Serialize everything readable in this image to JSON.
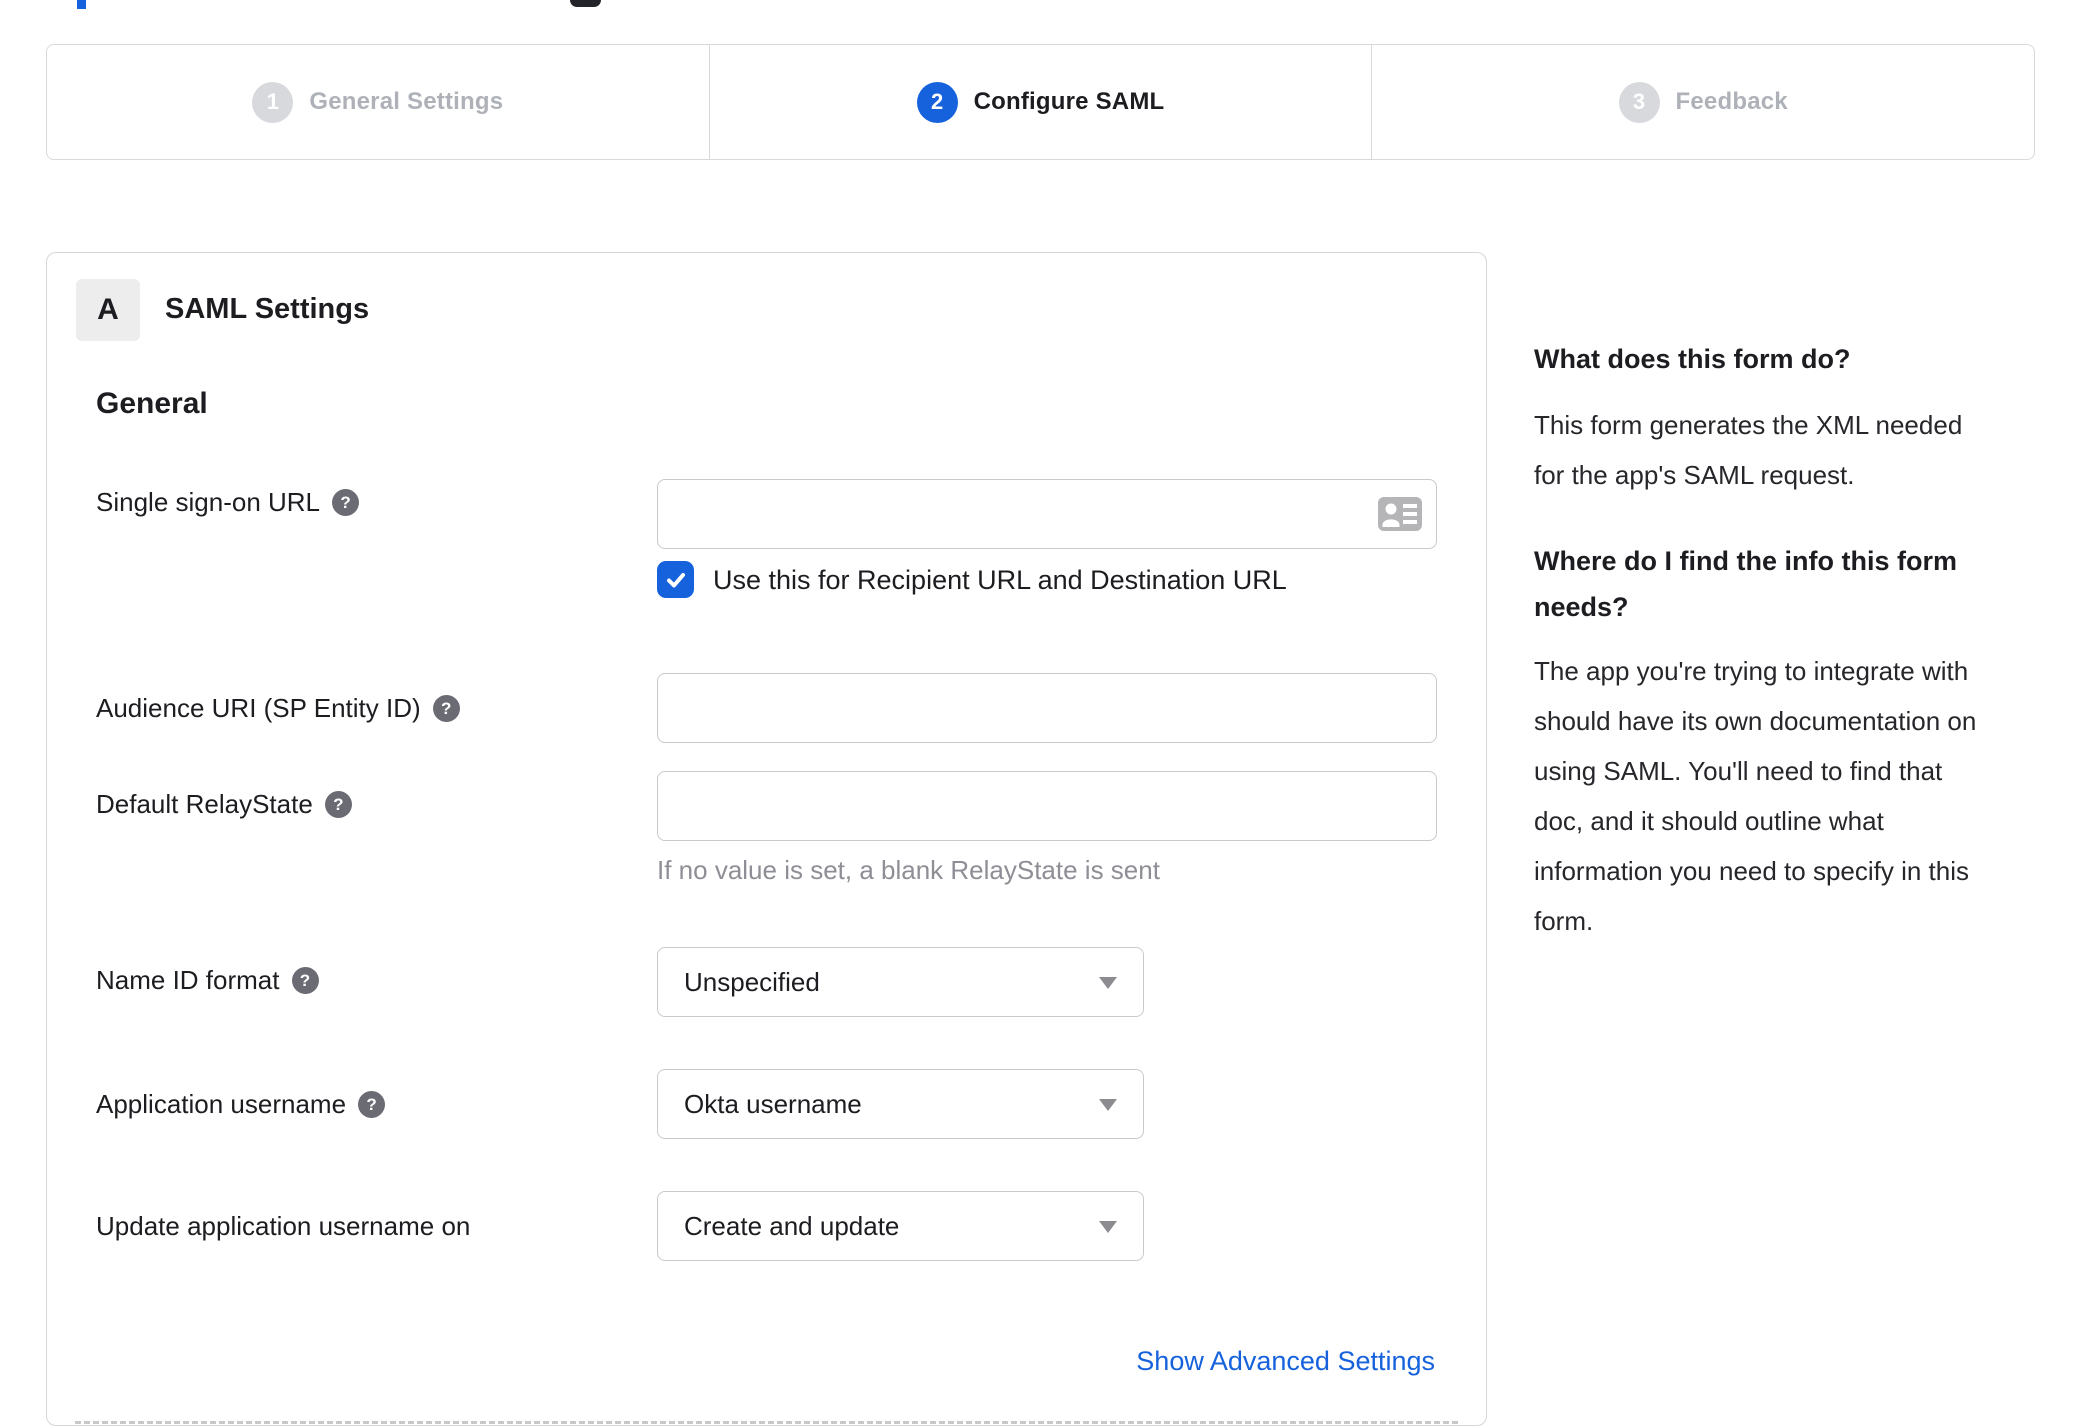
{
  "colors": {
    "accent_blue": "#1662dd",
    "inactive_gray": "#aeb2b8",
    "step_circle_gray": "#d7d9dc",
    "help_icon_gray": "#6b6b74",
    "hint_gray": "#8e8e96"
  },
  "icons": {
    "help_glyph": "?"
  },
  "stepper": {
    "steps": [
      {
        "number": "1",
        "label": "General Settings",
        "active": false
      },
      {
        "number": "2",
        "label": "Configure SAML",
        "active": true
      },
      {
        "number": "3",
        "label": "Feedback",
        "active": false
      }
    ]
  },
  "form": {
    "badge": "A",
    "title": "SAML Settings",
    "section_heading": "General",
    "sso": {
      "label": "Single sign-on URL",
      "value": "",
      "checkbox_label": "Use this for Recipient URL and Destination URL",
      "checked": true
    },
    "audience": {
      "label": "Audience URI (SP Entity ID)",
      "value": ""
    },
    "relay": {
      "label": "Default RelayState",
      "value": "",
      "hint": "If no value is set, a blank RelayState is sent"
    },
    "name_id": {
      "label": "Name ID format",
      "selected": "Unspecified"
    },
    "app_username": {
      "label": "Application username",
      "selected": "Okta username"
    },
    "update_username": {
      "label": "Update application username on",
      "selected": "Create and update"
    },
    "advanced_link": "Show Advanced Settings"
  },
  "sidebar": {
    "q1": "What does this form do?",
    "a1_lines": [
      "This form generates the XML needed",
      "for the app's SAML request."
    ],
    "q2_lines": [
      "Where do I find the info this form",
      "needs?"
    ],
    "a2_lines": [
      "The app you're trying to integrate with",
      "should have its own documentation on",
      "using SAML. You'll need to find that",
      "doc, and it should outline what",
      "information you need to specify in this",
      "form."
    ]
  }
}
